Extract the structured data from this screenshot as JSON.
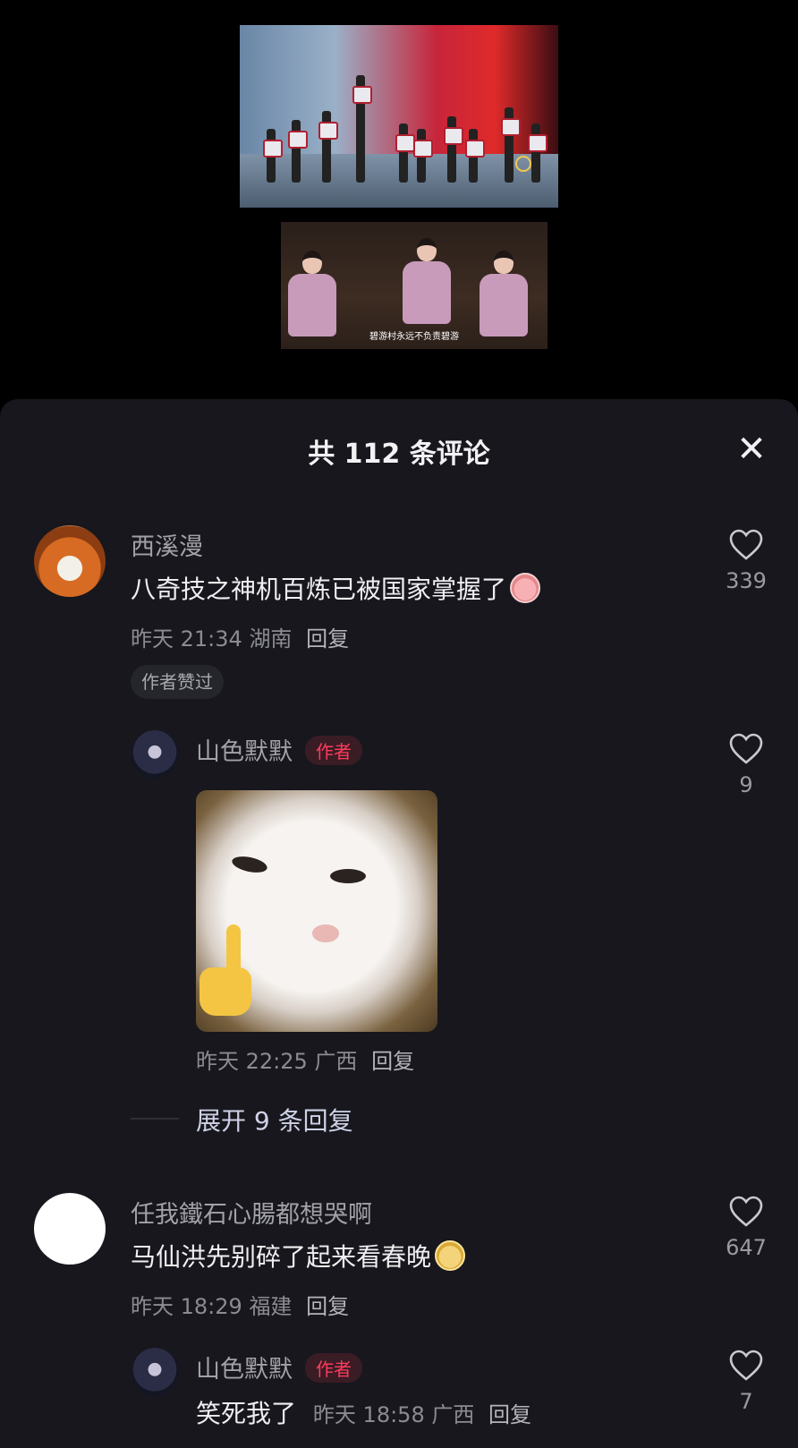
{
  "video": {
    "subtitle": "碧游村永远不负责碧游"
  },
  "sheet": {
    "title": "共 112 条评论",
    "close_icon": "close-icon"
  },
  "comments": [
    {
      "username": "西溪漫",
      "text": "八奇技之神机百炼已被国家掌握了",
      "emoji": "pig-face-emoji",
      "time": "昨天 21:34",
      "location": "湖南",
      "reply_label": "回复",
      "likes": "339",
      "author_liked": "作者赞过",
      "reply": {
        "username": "山色默默",
        "badge": "作者",
        "sticker": "cat-finger-sticker",
        "time": "昨天 22:25",
        "location": "广西",
        "reply_label": "回复",
        "likes": "9"
      },
      "expand_label": "展开 9 条回复"
    },
    {
      "username": "任我鐵石心腸都想哭啊",
      "text": "马仙洪先别碎了起来看春晚",
      "emoji": "dog-face-emoji",
      "time": "昨天 18:29",
      "location": "福建",
      "reply_label": "回复",
      "likes": "647",
      "reply": {
        "username": "山色默默",
        "badge": "作者",
        "text": "笑死我了",
        "time": "昨天 18:58",
        "location": "广西",
        "reply_label": "回复",
        "likes": "7"
      }
    }
  ]
}
